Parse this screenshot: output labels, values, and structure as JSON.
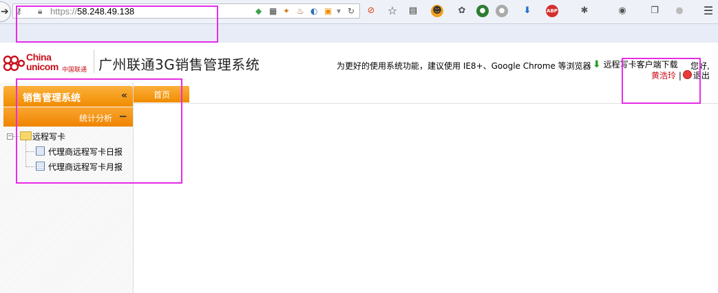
{
  "browser": {
    "url_scheme": "https://",
    "url_host": "58.248.49.138",
    "toolbar_icons": [
      "shield-icon",
      "qr-icon",
      "fox-icon",
      "java-icon",
      "swirl-icon",
      "tag-icon",
      "dropdown-icon",
      "reload-icon",
      "block-icon",
      "bookmark-star-icon",
      "reading-list-icon",
      "extension-icon",
      "palette-icon",
      "green-extension-icon",
      "grey-extension-icon",
      "download-arrow-icon",
      "adblock-icon",
      "bug-icon",
      "eye-icon",
      "window-icon",
      "circle-icon",
      "menu-icon"
    ],
    "adblock_label": "ABP"
  },
  "header": {
    "logo_line1": "China",
    "logo_line2": "unicom",
    "logo_cn": "中国联通",
    "system_title": "广州联通3G销售管理系统",
    "browser_hint": "为更好的使用系统功能，建议使用 IE8+、Google Chrome 等浏览器",
    "download_label": "远程写卡客户端下载",
    "greeting": "您好,",
    "user_name": "黄浩玲",
    "separator": "|",
    "logout_label": "退出"
  },
  "sidebar": {
    "panel_title": "销售管理系统",
    "collapse_glyph": "«",
    "section_label": "统计分析",
    "section_toggle": "−",
    "tree": {
      "folder_label": "远程写卡",
      "toggle_glyph": "−",
      "items": [
        {
          "label": "代理商远程写卡日报"
        },
        {
          "label": "代理商远程写卡月报"
        }
      ]
    }
  },
  "main": {
    "tabs": [
      {
        "label": "首页"
      }
    ]
  },
  "colors": {
    "accent_orange": "#f08c00",
    "brand_red": "#c8101c",
    "annotation_magenta": "#e62be6"
  }
}
